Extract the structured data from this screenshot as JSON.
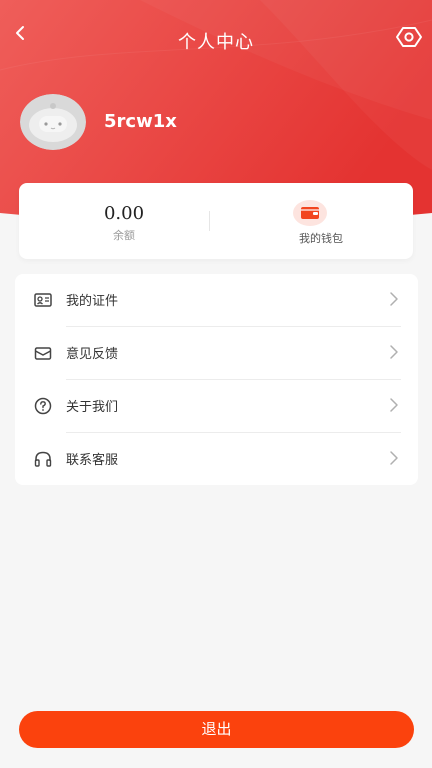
{
  "header": {
    "title": "个人中心",
    "back_icon": "chevron-left-icon",
    "settings_icon": "hexagon-gear-icon",
    "gradient_start": "#ef5e5a",
    "gradient_end": "#e43331"
  },
  "profile": {
    "avatar_icon": "robot-avatar-icon",
    "username": "5rcw1x"
  },
  "wallet_card": {
    "balance_value": "0.00",
    "balance_label": "余额",
    "wallet_label": "我的钱包",
    "wallet_icon": "wallet-icon",
    "wallet_icon_color": "#f2451e"
  },
  "menu": {
    "items": [
      {
        "label": "我的证件",
        "icon": "id-card-icon"
      },
      {
        "label": "意见反馈",
        "icon": "envelope-icon"
      },
      {
        "label": "关于我们",
        "icon": "question-circle-icon"
      },
      {
        "label": "联系客服",
        "icon": "headset-icon"
      }
    ],
    "arrow_icon": "chevron-right-icon"
  },
  "logout": {
    "label": "退出",
    "color": "#fb420d"
  },
  "page": {
    "background": "#f6f6f6"
  }
}
